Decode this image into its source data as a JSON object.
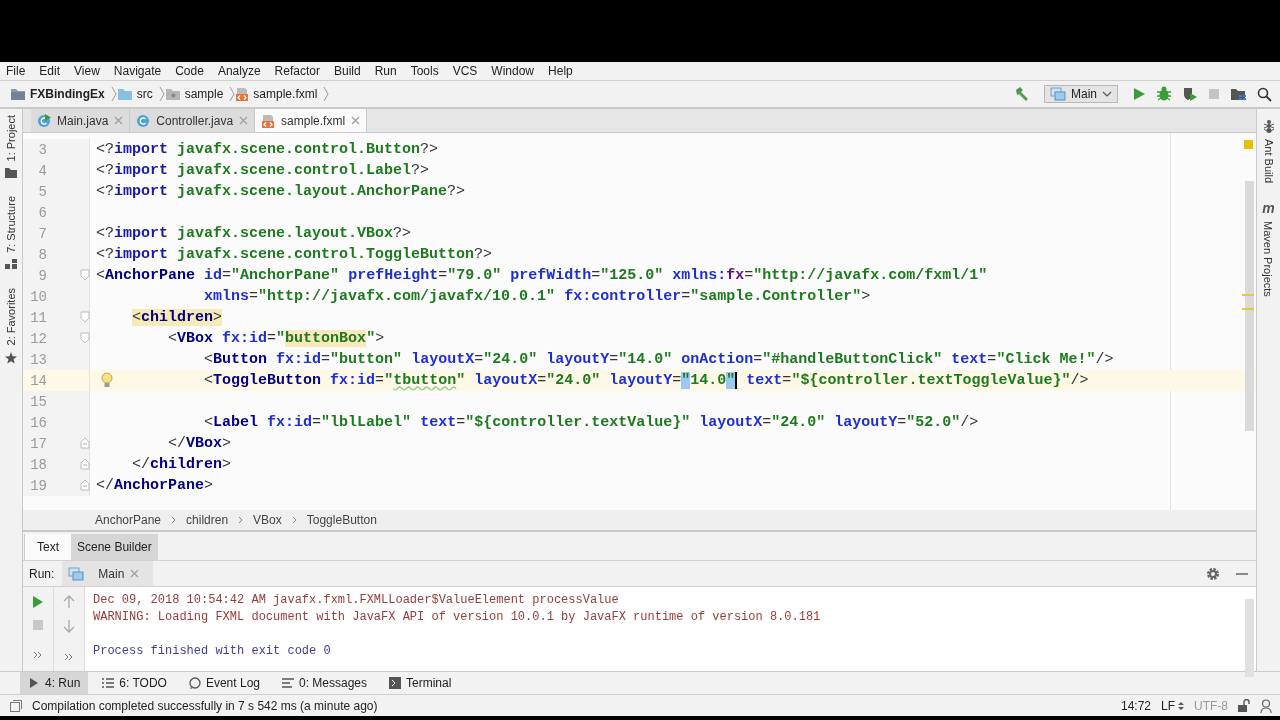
{
  "menu": [
    "File",
    "Edit",
    "View",
    "Navigate",
    "Code",
    "Analyze",
    "Refactor",
    "Build",
    "Run",
    "Tools",
    "VCS",
    "Window",
    "Help"
  ],
  "breadcrumbs": [
    {
      "kind": "project",
      "label": "FXBindingEx"
    },
    {
      "kind": "folder",
      "label": "src"
    },
    {
      "kind": "package",
      "label": "sample"
    },
    {
      "kind": "fxml",
      "label": "sample.fxml"
    }
  ],
  "run_config": "Main",
  "editor_tabs": [
    {
      "kind": "java-main",
      "label": "Main.java",
      "selected": false
    },
    {
      "kind": "java",
      "label": "Controller.java",
      "selected": false
    },
    {
      "kind": "fxml",
      "label": "sample.fxml",
      "selected": true
    }
  ],
  "left_tools": [
    {
      "kind": "project",
      "label": "1: Project"
    },
    {
      "kind": "structure",
      "label": "7: Structure"
    },
    {
      "kind": "favorites",
      "label": "2: Favorites"
    }
  ],
  "right_tools": [
    {
      "kind": "ant",
      "label": "Ant Build"
    },
    {
      "kind": "maven",
      "label": "Maven Projects",
      "badge": "m"
    }
  ],
  "lines": [
    {
      "number": "3",
      "kind": "plain",
      "current": false,
      "tokens": [
        {
          "kind": "punct",
          "text": "<?"
        },
        {
          "kind": "keyword",
          "text": "import"
        },
        {
          "kind": "name",
          "text": " javafx.scene.control.Button"
        },
        {
          "kind": "punct",
          "text": "?>"
        }
      ]
    },
    {
      "number": "4",
      "kind": "plain",
      "current": false,
      "tokens": [
        {
          "kind": "punct",
          "text": "<?"
        },
        {
          "kind": "keyword",
          "text": "import"
        },
        {
          "kind": "name",
          "text": " javafx.scene.control.Label"
        },
        {
          "kind": "punct",
          "text": "?>"
        }
      ]
    },
    {
      "number": "5",
      "kind": "plain",
      "current": false,
      "tokens": [
        {
          "kind": "punct",
          "text": "<?"
        },
        {
          "kind": "keyword",
          "text": "import"
        },
        {
          "kind": "name",
          "text": " javafx.scene.layout.AnchorPane"
        },
        {
          "kind": "punct",
          "text": "?>"
        }
      ]
    },
    {
      "number": "6",
      "kind": "plain",
      "current": false
    },
    {
      "number": "7",
      "kind": "plain",
      "current": false,
      "tokens": [
        {
          "kind": "punct",
          "text": "<?"
        },
        {
          "kind": "keyword",
          "text": "import"
        },
        {
          "kind": "name",
          "text": " javafx.scene.layout.VBox"
        },
        {
          "kind": "punct",
          "text": "?>"
        }
      ]
    },
    {
      "number": "8",
      "kind": "plain",
      "current": false,
      "tokens": [
        {
          "kind": "punct",
          "text": "<?"
        },
        {
          "kind": "keyword",
          "text": "import"
        },
        {
          "kind": "name",
          "text": " javafx.scene.control.ToggleButton"
        },
        {
          "kind": "punct",
          "text": "?>"
        }
      ]
    },
    {
      "number": "9",
      "kind": "fold-start",
      "current": false,
      "tokens": [
        {
          "kind": "punct",
          "text": "<"
        },
        {
          "kind": "tag",
          "text": "AnchorPane"
        },
        {
          "kind": "attr",
          "text": " id"
        },
        {
          "kind": "punct",
          "text": "="
        },
        {
          "kind": "value",
          "text": "\"AnchorPane\""
        },
        {
          "kind": "attr",
          "text": " prefHeight"
        },
        {
          "kind": "punct",
          "text": "="
        },
        {
          "kind": "value",
          "text": "\"79.0\""
        },
        {
          "kind": "attr",
          "text": " prefWidth"
        },
        {
          "kind": "punct",
          "text": "="
        },
        {
          "kind": "value",
          "text": "\"125.0\""
        },
        {
          "kind": "attr",
          "text": " xmlns:"
        },
        {
          "kind": "ns",
          "text": "fx"
        },
        {
          "kind": "punct",
          "text": "="
        },
        {
          "kind": "value",
          "text": "\"http://javafx.com/fxml/1\""
        }
      ]
    },
    {
      "number": "10",
      "kind": "plain",
      "current": false,
      "tokens": [
        {
          "kind": "attr",
          "text": "            xmlns"
        },
        {
          "kind": "punct",
          "text": "="
        },
        {
          "kind": "value",
          "text": "\"http://javafx.com/javafx/10.0.1\""
        },
        {
          "kind": "attr",
          "text": " fx:controller"
        },
        {
          "kind": "punct",
          "text": "="
        },
        {
          "kind": "value",
          "text": "\"sample.Controller\""
        },
        {
          "kind": "punct",
          "text": ">"
        }
      ]
    },
    {
      "number": "11",
      "kind": "fold-start",
      "current": false,
      "tokens": [
        {
          "kind": "punct-match",
          "text": "    <"
        },
        {
          "kind": "tag-match",
          "text": "children"
        },
        {
          "kind": "punct-match",
          "text": ">"
        }
      ]
    },
    {
      "number": "12",
      "kind": "fold-start",
      "current": false,
      "tokens": [
        {
          "kind": "punct",
          "text": "        <"
        },
        {
          "kind": "tag",
          "text": "VBox"
        },
        {
          "kind": "attr",
          "text": " fx:id"
        },
        {
          "kind": "punct",
          "text": "="
        },
        {
          "kind": "value",
          "text": "\""
        },
        {
          "kind": "value-match",
          "text": "buttonBox"
        },
        {
          "kind": "value",
          "text": "\""
        },
        {
          "kind": "punct",
          "text": ">"
        }
      ]
    },
    {
      "number": "13",
      "kind": "plain",
      "current": false,
      "tokens": [
        {
          "kind": "punct",
          "text": "            <"
        },
        {
          "kind": "tag",
          "text": "Button"
        },
        {
          "kind": "attr",
          "text": " fx:id"
        },
        {
          "kind": "punct",
          "text": "="
        },
        {
          "kind": "value",
          "text": "\"button\""
        },
        {
          "kind": "attr",
          "text": " layoutX"
        },
        {
          "kind": "punct",
          "text": "="
        },
        {
          "kind": "value",
          "text": "\"24.0\""
        },
        {
          "kind": "attr",
          "text": " layoutY"
        },
        {
          "kind": "punct",
          "text": "="
        },
        {
          "kind": "value",
          "text": "\"14.0\""
        },
        {
          "kind": "attr",
          "text": " onAction"
        },
        {
          "kind": "punct",
          "text": "="
        },
        {
          "kind": "value",
          "text": "\"#handleButtonClick\""
        },
        {
          "kind": "attr",
          "text": " text"
        },
        {
          "kind": "punct",
          "text": "="
        },
        {
          "kind": "value",
          "text": "\"Click Me!\""
        },
        {
          "kind": "punct",
          "text": "/>"
        }
      ]
    },
    {
      "number": "14",
      "kind": "plain",
      "current": true,
      "bulb": true,
      "tokens": [
        {
          "kind": "punct",
          "text": "            <"
        },
        {
          "kind": "tag",
          "text": "ToggleButton"
        },
        {
          "kind": "attr",
          "text": " fx:id"
        },
        {
          "kind": "punct",
          "text": "="
        },
        {
          "kind": "value",
          "text": "\""
        },
        {
          "kind": "value-typo",
          "text": "tbutton"
        },
        {
          "kind": "value",
          "text": "\""
        },
        {
          "kind": "attr",
          "text": " layoutX"
        },
        {
          "kind": "punct",
          "text": "="
        },
        {
          "kind": "value",
          "text": "\"24.0\""
        },
        {
          "kind": "attr",
          "text": " layoutY"
        },
        {
          "kind": "punct",
          "text": "="
        },
        {
          "kind": "value-brace",
          "text": "\""
        },
        {
          "kind": "value",
          "text": "14.0"
        },
        {
          "kind": "value-caret",
          "text": "\""
        },
        {
          "kind": "attr",
          "text": " text"
        },
        {
          "kind": "punct",
          "text": "="
        },
        {
          "kind": "value",
          "text": "\"${controller.textToggleValue}\""
        },
        {
          "kind": "punct",
          "text": "/>"
        }
      ]
    },
    {
      "number": "15",
      "kind": "plain",
      "current": false
    },
    {
      "number": "16",
      "kind": "plain",
      "current": false,
      "tokens": [
        {
          "kind": "punct",
          "text": "            <"
        },
        {
          "kind": "tag",
          "text": "Label"
        },
        {
          "kind": "attr",
          "text": " fx:id"
        },
        {
          "kind": "punct",
          "text": "="
        },
        {
          "kind": "value",
          "text": "\"lblLabel\""
        },
        {
          "kind": "attr",
          "text": " text"
        },
        {
          "kind": "punct",
          "text": "="
        },
        {
          "kind": "value",
          "text": "\"${controller.textValue}\""
        },
        {
          "kind": "attr",
          "text": " layoutX"
        },
        {
          "kind": "punct",
          "text": "="
        },
        {
          "kind": "value",
          "text": "\"24.0\""
        },
        {
          "kind": "attr",
          "text": " layoutY"
        },
        {
          "kind": "punct",
          "text": "="
        },
        {
          "kind": "value",
          "text": "\"52.0\""
        },
        {
          "kind": "punct",
          "text": "/>"
        }
      ]
    },
    {
      "number": "17",
      "kind": "fold-end",
      "current": false,
      "tokens": [
        {
          "kind": "punct",
          "text": "        </"
        },
        {
          "kind": "tag",
          "text": "VBox"
        },
        {
          "kind": "punct",
          "text": ">"
        }
      ]
    },
    {
      "number": "18",
      "kind": "fold-end",
      "current": false,
      "tokens": [
        {
          "kind": "punct",
          "text": "    </"
        },
        {
          "kind": "tag",
          "text": "children"
        },
        {
          "kind": "punct",
          "text": ">"
        }
      ]
    },
    {
      "number": "19",
      "kind": "fold-end",
      "current": false,
      "tokens": [
        {
          "kind": "punct",
          "text": "</"
        },
        {
          "kind": "tag",
          "text": "AnchorPane"
        },
        {
          "kind": "punct",
          "text": ">"
        }
      ]
    }
  ],
  "structure_path": [
    "AnchorPane",
    "children",
    "VBox",
    "ToggleButton"
  ],
  "view_tabs": [
    {
      "label": "Text",
      "selected": true
    },
    {
      "label": "Scene Builder",
      "selected": false
    }
  ],
  "run_panel": {
    "label": "Run:",
    "tab": "Main",
    "console": [
      {
        "kind": "error",
        "text": "Dec 09, 2018 10:54:42 AM javafx.fxml.FXMLLoader$ValueElement processValue"
      },
      {
        "kind": "error",
        "text": "WARNING: Loading FXML document with JavaFX API of version 10.0.1 by JavaFX runtime of version 8.0.181"
      },
      {
        "kind": "info",
        "text": "Process finished with exit code 0"
      }
    ]
  },
  "tool_windows": [
    {
      "kind": "run",
      "label": "4: Run",
      "selected": true
    },
    {
      "kind": "todo",
      "label": "6: TODO",
      "selected": false
    },
    {
      "kind": "log",
      "label": "Event Log",
      "selected": false
    },
    {
      "kind": "messages",
      "label": "0: Messages",
      "selected": false
    },
    {
      "kind": "terminal",
      "label": "Terminal",
      "selected": false
    }
  ],
  "status": {
    "message": "Compilation completed successfully in 7 s 542 ms (a minute ago)",
    "position": "14:72",
    "line_separator": "LF",
    "encoding": "UTF-8"
  }
}
